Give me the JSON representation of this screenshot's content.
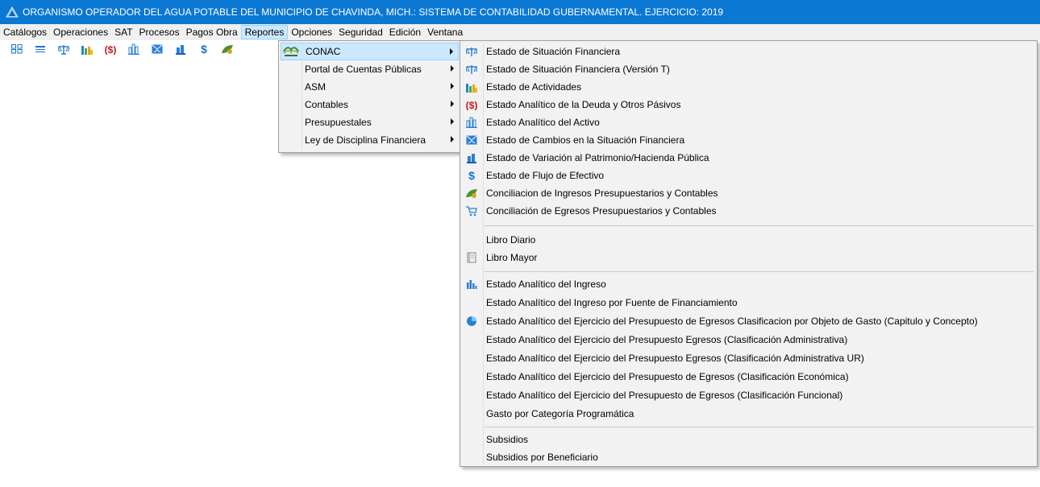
{
  "window": {
    "title": "ORGANISMO OPERADOR DEL AGUA POTABLE DEL MUNICIPIO DE CHAVINDA, MICH.: SISTEMA DE CONTABILIDAD GUBERNAMENTAL. EJERCICIO: 2019",
    "icon": "triangle-logo-icon"
  },
  "menubar": [
    {
      "label": "Catálogos"
    },
    {
      "label": "Operaciones"
    },
    {
      "label": "SAT"
    },
    {
      "label": "Procesos"
    },
    {
      "label": "Pagos Obra"
    },
    {
      "label": "Reportes"
    },
    {
      "label": "Opciones"
    },
    {
      "label": "Seguridad"
    },
    {
      "label": "Edición"
    },
    {
      "label": "Ventana"
    }
  ],
  "toolbar": [
    {
      "icon": "grid-icon"
    },
    {
      "icon": "list-icon"
    },
    {
      "icon": "balance-icon"
    },
    {
      "icon": "bar-chart-icon"
    },
    {
      "icon": "dollar-parentheses-icon"
    },
    {
      "icon": "building-chart-icon"
    },
    {
      "icon": "envelope-icon"
    },
    {
      "icon": "hand-money-icon"
    },
    {
      "icon": "dollar-icon"
    },
    {
      "icon": "leaf-money-icon"
    }
  ],
  "reportes_menu": [
    {
      "label": "CONAC",
      "icon": "conac-logo-icon"
    },
    {
      "label": "Portal de Cuentas Públicas"
    },
    {
      "label": "ASM"
    },
    {
      "label": "Contables"
    },
    {
      "label": "Presupuestales"
    },
    {
      "label": "Ley de Disciplina Financiera"
    }
  ],
  "conac_menu": [
    {
      "label": "Estado de Situación Financiera",
      "icon": "balance-icon"
    },
    {
      "label": "Estado de Situación Financiera (Versión T)",
      "icon": "balance-icon"
    },
    {
      "label": "Estado de Actividades",
      "icon": "bar-chart-icon"
    },
    {
      "label": "Estado Analítico de la Deuda y Otros Pásivos",
      "icon": "dollar-parentheses-icon"
    },
    {
      "label": "Estado Analítico del Activo",
      "icon": "building-chart-icon"
    },
    {
      "label": "Estado de Cambios en la Situación Financiera",
      "icon": "envelope-icon"
    },
    {
      "label": "Estado de Variación al Patrimonio/Hacienda Pública",
      "icon": "hand-money-icon"
    },
    {
      "label": "Estado de Flujo de Efectivo",
      "icon": "dollar-icon"
    },
    {
      "label": "Conciliacion de Ingresos Presupuestarios y Contables",
      "icon": "leaf-money-icon"
    },
    {
      "label": "Conciliación de Egresos Presupuestarios y Contables",
      "icon": "cart-icon"
    },
    {
      "label": "Libro Diario"
    },
    {
      "label": "Libro Mayor",
      "icon": "book-icon"
    },
    {
      "label": "Estado Analítico del Ingreso",
      "icon": "columns-chart-icon"
    },
    {
      "label": "Estado Analítico del Ingreso por Fuente de Financiamiento"
    },
    {
      "label": "Estado Analítico del Ejercicio del Presupuesto de Egresos Clasificacion por Objeto de Gasto (Capitulo y Concepto)",
      "icon": "pie-chart-icon"
    },
    {
      "label": "Estado Analítico del Ejercicio del Presupuesto Egresos (Clasificación Administrativa)"
    },
    {
      "label": "Estado Analítico del Ejercicio del Presupuesto Egresos (Clasificación Administrativa UR)"
    },
    {
      "label": "Estado Analítico del Ejercicio del Presupuesto de Egresos (Clasificación Económica)"
    },
    {
      "label": "Estado Analítico del Ejercicio del Presupuesto de Egresos (Clasificación Funcional)"
    },
    {
      "label": "Gasto por Categoría Programática"
    },
    {
      "label": "Subsidios"
    },
    {
      "label": "Subsidios por Beneficiario"
    }
  ],
  "colors": {
    "titlebar": "#0b78d4",
    "menu_highlight": "#cce8ff",
    "menu_background": "#f2f2f2"
  }
}
